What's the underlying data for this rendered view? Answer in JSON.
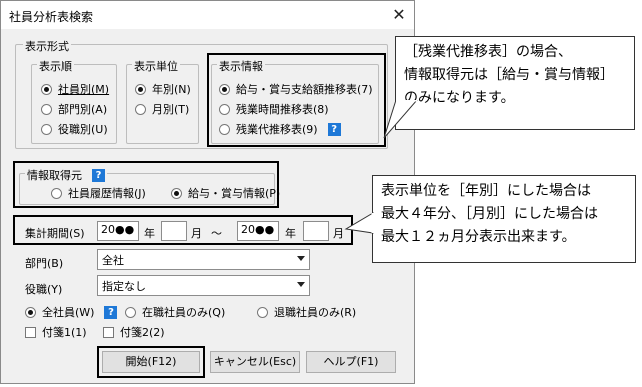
{
  "window": {
    "title": "社員分析表検索",
    "close_glyph": "✕"
  },
  "display_format": {
    "legend": "表示形式",
    "order": {
      "legend": "表示順",
      "options": [
        "社員別(M)",
        "部門別(A)",
        "役職別(U)"
      ],
      "selected": 0
    },
    "unit": {
      "legend": "表示単位",
      "options": [
        "年別(N)",
        "月別(T)"
      ],
      "selected": 0
    },
    "info": {
      "legend": "表示情報",
      "options": [
        "給与・賞与支給額推移表(7)",
        "残業時間推移表(8)",
        "残業代推移表(9)"
      ],
      "selected": 0
    }
  },
  "source": {
    "legend": "情報取得元",
    "options": [
      "社員履歴情報(J)",
      "給与・賞与情報(P)"
    ],
    "selected": 1
  },
  "period": {
    "label": "集計期間(S)",
    "from_year": "20●●",
    "year_unit": "年",
    "from_month": "",
    "month_unit": "月",
    "tilde": "～",
    "to_year": "20●●",
    "to_month": ""
  },
  "department": {
    "label": "部門(B)",
    "value": "全社"
  },
  "position": {
    "label": "役職(Y)",
    "value": "指定なし"
  },
  "employee_filter": {
    "options": [
      "全社員(W)",
      "在職社員のみ(Q)",
      "退職社員のみ(R)"
    ],
    "selected": 0
  },
  "checkboxes": [
    "付箋1(1)",
    "付箋2(2)"
  ],
  "buttons": {
    "start": "開始(F12)",
    "cancel": "キャンセル(Esc)",
    "help": "ヘルプ(F1)"
  },
  "help_glyph": "?",
  "callouts": {
    "info_note": [
      "［残業代推移表］の場合、",
      "情報取得元は［給与・賞与情報］",
      "のみになります。"
    ],
    "period_note": [
      "表示単位を［年別］にした場合は",
      "最大４年分、［月別］にした場合は",
      "最大１２ヵ月分表示出来ます。"
    ]
  },
  "colors": {
    "help_icon": "#1e78d7",
    "dialog_bg": "#f0f0f0"
  }
}
